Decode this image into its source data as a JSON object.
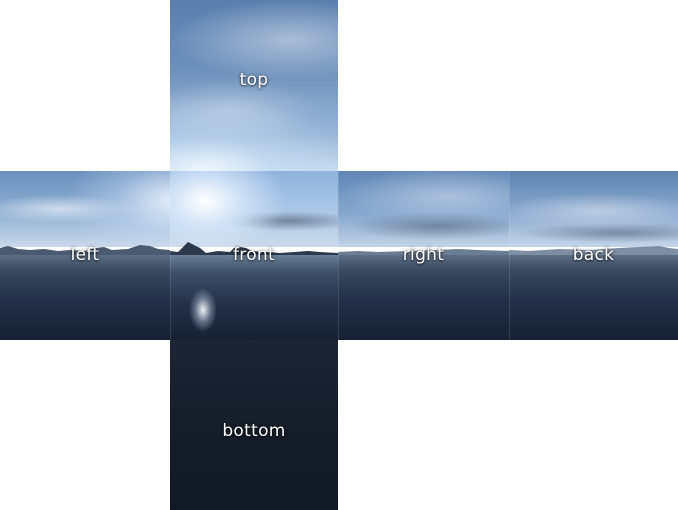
{
  "faces": {
    "top": "top",
    "left": "left",
    "front": "front",
    "right": "right",
    "back": "back",
    "bottom": "bottom"
  }
}
